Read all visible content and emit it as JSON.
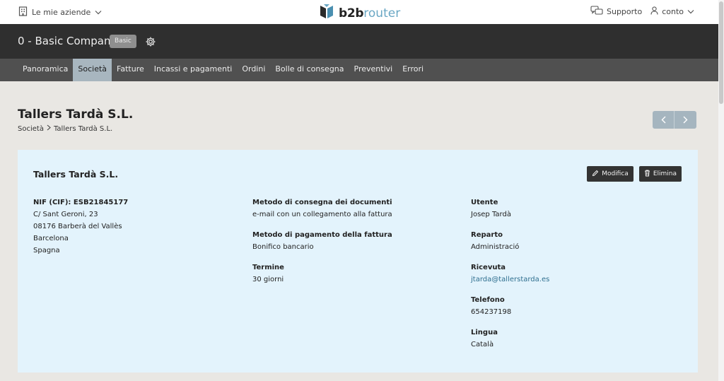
{
  "topbar": {
    "companies_label": "Le mie aziende",
    "brand_b2b": "b2b",
    "brand_router": "router",
    "support_label": "Supporto",
    "account_label": "conto"
  },
  "company": {
    "name": "0 - Basic Company",
    "plan_badge": "Basic"
  },
  "nav": {
    "items": [
      "Panoramica",
      "Società",
      "Fatture",
      "Incassi e pagamenti",
      "Ordini",
      "Bolle di consegna",
      "Preventivi",
      "Errori"
    ],
    "active": "Società"
  },
  "page": {
    "title": "Tallers Tardà S.L.",
    "breadcrumb": [
      "Società",
      "Tallers Tardà S.L."
    ]
  },
  "card": {
    "title": "Tallers Tardà S.L.",
    "edit_label": "Modifica",
    "delete_label": "Elimina",
    "address": {
      "nif": "NIF (CIF): ESB21845177",
      "street": "C/ Sant Geroni, 23",
      "postal_city": "08176 Barberà del Vallès",
      "province": "Barcelona",
      "country": "Spagna"
    },
    "fields_mid": [
      {
        "label": "Metodo di consegna dei documenti",
        "value": "e-mail con un collegamento alla fattura"
      },
      {
        "label": "Metodo di pagamento della fattura",
        "value": "Bonifico bancario"
      },
      {
        "label": "Termine",
        "value": "30 giorni"
      }
    ],
    "fields_right": [
      {
        "label": "Utente",
        "value": "Josep Tardà"
      },
      {
        "label": "Reparto",
        "value": "Administració"
      },
      {
        "label": "Ricevuta",
        "value": "jtarda@tallerstarda.es"
      },
      {
        "label": "Telefono",
        "value": "654237198"
      },
      {
        "label": "Lingua",
        "value": "Català"
      }
    ]
  }
}
